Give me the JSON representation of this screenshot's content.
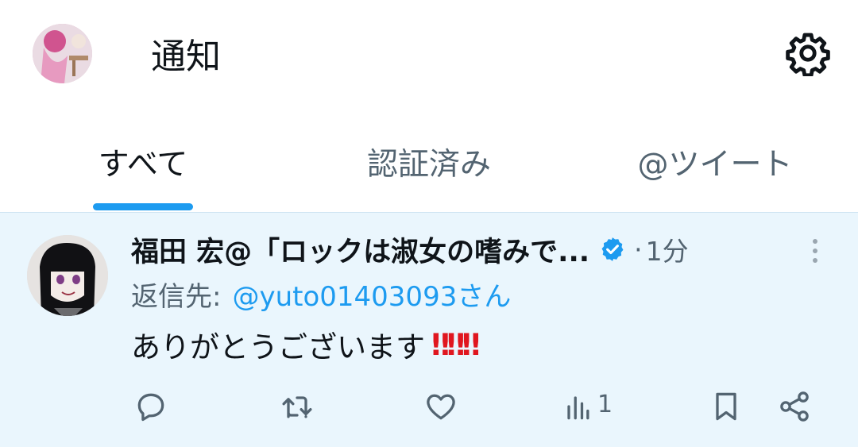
{
  "header": {
    "title": "通知",
    "avatar_icon": "profile-avatar",
    "settings_icon": "gear-icon"
  },
  "tabs": [
    {
      "label": "すべて",
      "active": true
    },
    {
      "label": "認証済み",
      "active": false
    },
    {
      "label": "@ツイート",
      "active": false
    }
  ],
  "tweet": {
    "author_name": "福田 宏@「ロックは淑女の嗜みで...",
    "verified": true,
    "separator": "·",
    "time": "1分",
    "reply_label": "返信先:",
    "reply_handle": "@yuto01403093さん",
    "text": "ありがとうございます",
    "emphasis": "‼‼‼",
    "views_count": "1"
  },
  "colors": {
    "accent": "#1d9bf0",
    "tweet_background": "#eaf6fd",
    "secondary_text": "#536471",
    "emphasis": "#e0161f"
  }
}
